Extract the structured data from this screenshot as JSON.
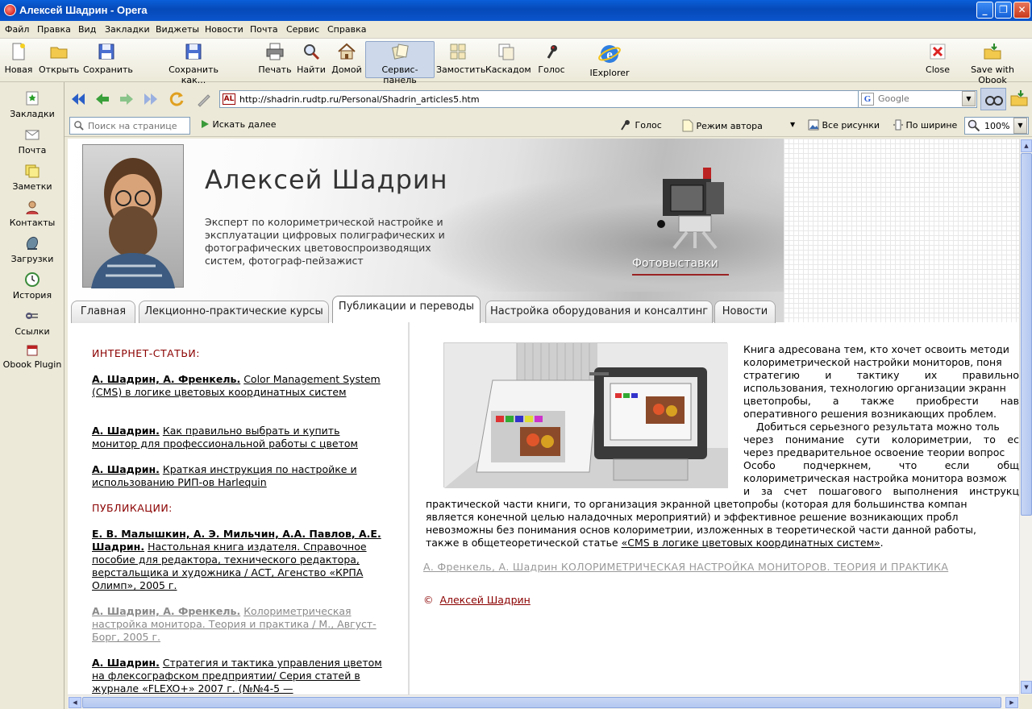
{
  "window": {
    "title": "Алексей Шадрин - Opera"
  },
  "menu": [
    "Файл",
    "Правка",
    "Вид",
    "Закладки",
    "Виджеты",
    "Новости",
    "Почта",
    "Сервис",
    "Справка"
  ],
  "toolbar": {
    "new": "Новая",
    "open": "Открыть",
    "save": "Сохранить",
    "save_as": "Сохранить как...",
    "print": "Печать",
    "find": "Найти",
    "home": "Домой",
    "service_panel": "Сервис-панель",
    "tile": "Замостить",
    "cascade": "Каскадом",
    "voice": "Голос",
    "iexplorer": "IExplorer",
    "close": "Close",
    "save_obook": "Save with Obook"
  },
  "panel": [
    "Закладки",
    "Почта",
    "Заметки",
    "Контакты",
    "Загрузки",
    "История",
    "Ссылки",
    "Obook Plugin"
  ],
  "address": {
    "url": "http://shadrin.rudtp.ru/Personal/Shadrin_articles5.htm",
    "favicon": "AL",
    "help": "?"
  },
  "search": {
    "placeholder": "Google",
    "engine_glyph": "G"
  },
  "findbar": {
    "placeholder": "Поиск на странице",
    "find_next": "Искать далее",
    "voice": "Голос",
    "author_mode": "Режим автора",
    "all_images": "Все рисунки",
    "fit_width": "По ширине",
    "zoom": "100%"
  },
  "site": {
    "title": "Алексей Шадрин",
    "subtitle": "Эксперт по колориметрической настройке и эксплуатации цифровых полиграфических и фотографических цветовоспроизводящих систем, фотограф-пейзажист",
    "exhibitions": "Фотовыставки",
    "tabs": [
      "Главная",
      "Лекционно-практические курсы",
      "Публикации и переводы",
      "Настройка оборудования и консалтинг",
      "Новости"
    ]
  },
  "left": {
    "section1": "ИНТЕРНЕТ-СТАТЬИ:",
    "section2": "ПУБЛИКАЦИИ:",
    "articles": [
      {
        "authors": "А. Шадрин, А. Френкель.",
        "title": "Color Management System (CMS) в логике цветовых координатных систем"
      },
      {
        "authors": "А. Шадрин.",
        "title": "Как правильно выбрать и купить монитор для профессиональной работы с цветом"
      },
      {
        "authors": "А. Шадрин.",
        "title": "Краткая инструкция по настройке и использованию РИП-ов Harlequin"
      }
    ],
    "publications": [
      {
        "authors": "Е. В. Малышкин, А. Э. Мильчин, А.А. Павлов, А.Е. Шадрин.",
        "title": "Настольная книга издателя. Справочное пособие для редактора, технического редактора, верстальщика и художника / АСТ, Агенство «КРПА Олимп», 2005 г."
      },
      {
        "authors": "А. Шадрин, А. Френкель.",
        "title": "Колориметрическая настройка монитора. Теория и практика / М., Август-Борг, 2005 г."
      },
      {
        "authors": "А. Шадрин.",
        "title": "Стратегия и тактика управления цветом на флексографском предприятии/ Серия статей в журнале «FLEXO+» 2007 г. (№№4-5 —"
      }
    ]
  },
  "right": {
    "p1": [
      "Книга адресована тем, кто хочет освоить методи",
      "колориметрической настройки мониторов, поня",
      "стратегию и тактику их правильно",
      "использования, технологию организации экранн",
      "цветопробы, а также приобрести нав",
      "оперативного решения возникающих проблем."
    ],
    "p2": [
      "Добиться серьезного результата можно толь",
      "через понимание сути колориметрии, то ес",
      "через предварительное освоение теории вопрос",
      "Особо подчеркнем, что если общ",
      "колориметрическая настройка монитора возмож",
      "и за счет пошагового выполнения инструкц"
    ],
    "p3": [
      "практической части книги, то организация экранной цветопробы (которая для большинства компан",
      "является конечной целью наладочных мероприятий) и эффективное решение возникающих пробл",
      "невозможны без понимания основ колориметрии, изложенных в теоретической части данной работы,"
    ],
    "p3_last_pre": "также в общетеоретической статье ",
    "p3_link": "«CMS в логике цветовых координатных систем»",
    "p3_last_post": ".",
    "book_link": "А. Френкель, А. Шадрин КОЛОРИМЕТРИЧЕСКАЯ НАСТРОЙКА МОНИТОРОВ. ТЕОРИЯ И ПРАКТИКА",
    "copyright_symbol": "©",
    "copyright_name": "Алексей Шадрин"
  },
  "colors": {
    "title_bar": "#0a5fd8",
    "section_red": "#8b0000",
    "link_grey": "#8a8a8a"
  }
}
